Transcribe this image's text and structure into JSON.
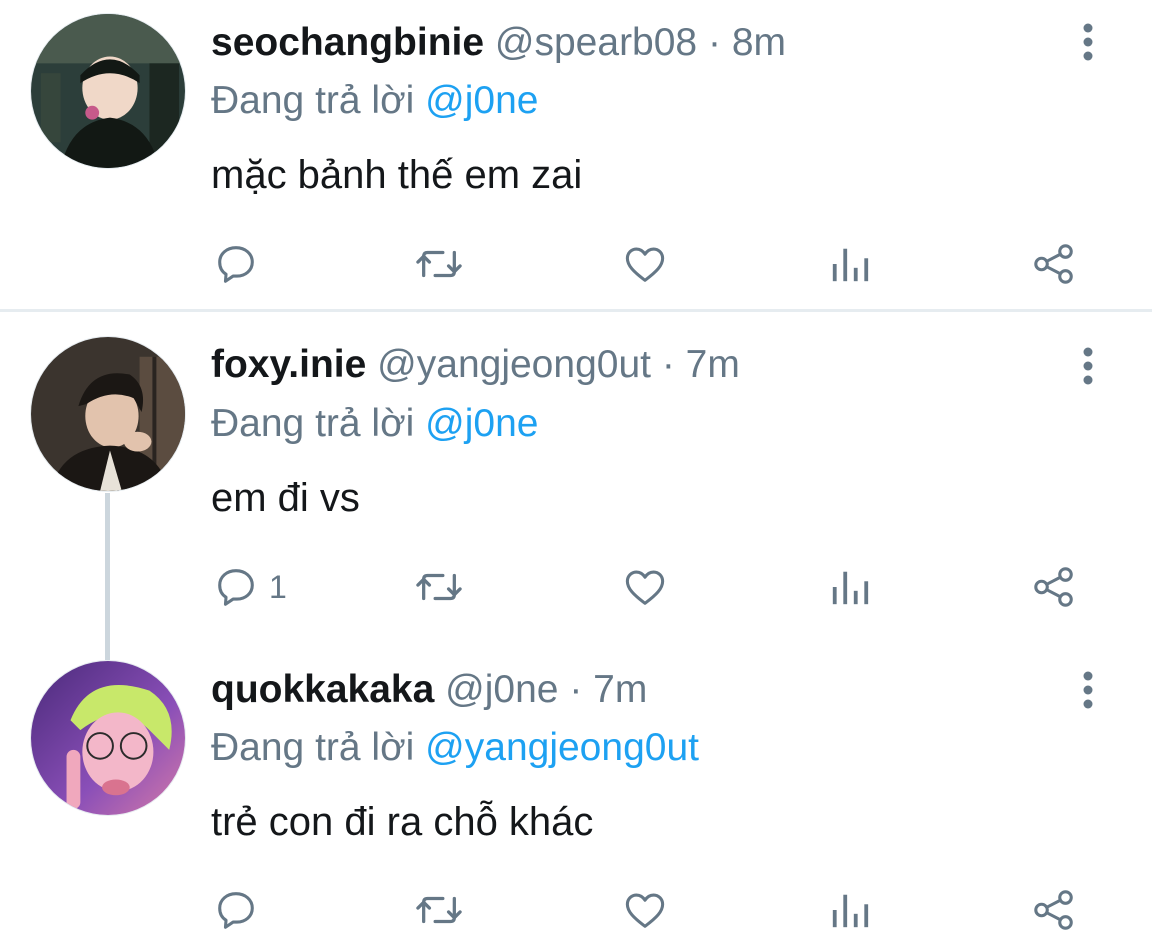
{
  "tweets": [
    {
      "display_name": "seochangbinie",
      "handle": "@spearb08",
      "separator": "·",
      "time": "8m",
      "reply_prefix": "Đang trả lời",
      "reply_to": "@j0ne",
      "text": "mặc bảnh thế em zai",
      "reply_count": "",
      "avatar_colors": [
        "#2c3e3a",
        "#121814",
        "#f0d8c8"
      ]
    },
    {
      "display_name": "foxy.inie",
      "handle": "@yangjeong0ut",
      "separator": "·",
      "time": "7m",
      "reply_prefix": "Đang trả lời",
      "reply_to": "@j0ne",
      "text": "em đi vs",
      "reply_count": "1",
      "avatar_colors": [
        "#3b342e",
        "#1b1714",
        "#e2c3ad"
      ]
    },
    {
      "display_name": "quokkakaka",
      "handle": "@j0ne",
      "separator": "·",
      "time": "7m",
      "reply_prefix": "Đang trả lời",
      "reply_to": "@yangjeong0ut",
      "text": "trẻ con đi ra chỗ khác",
      "reply_count": "",
      "avatar_colors": [
        "#6b3fa0",
        "#c8e86a",
        "#f3b7c9"
      ]
    }
  ],
  "icons": {
    "reply": "reply-icon",
    "retweet": "retweet-icon",
    "like": "heart-icon",
    "analytics": "analytics-icon",
    "share": "share-icon",
    "more": "more-vertical-icon"
  },
  "colors": {
    "text_primary": "#14171a",
    "text_secondary": "#657786",
    "mention": "#1da1f2",
    "divider": "#e6ecf0",
    "thread_line": "#ccd6dd"
  }
}
